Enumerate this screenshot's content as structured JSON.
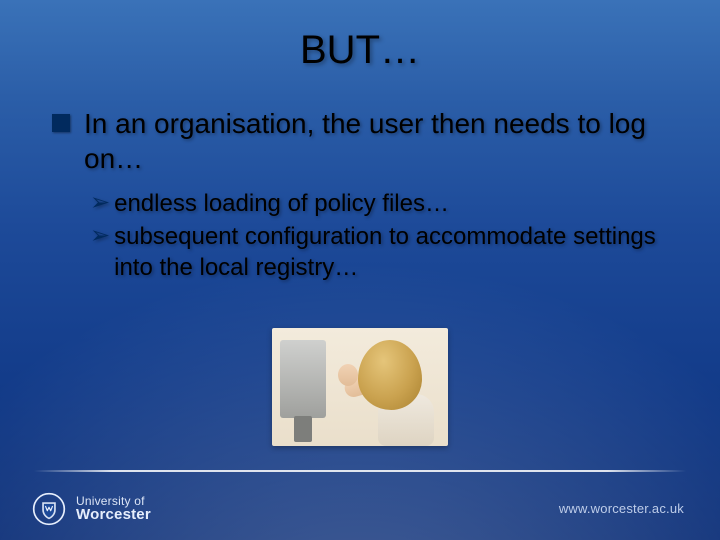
{
  "title": "BUT…",
  "bullet1": "In an organisation, the user then needs to log on…",
  "sub": [
    "endless loading of policy files…",
    "subsequent configuration to accommodate settings into the local registry…"
  ],
  "logo": {
    "line1": "University of",
    "line2": "Worcester"
  },
  "footer_url": "www.worcester.ac.uk"
}
